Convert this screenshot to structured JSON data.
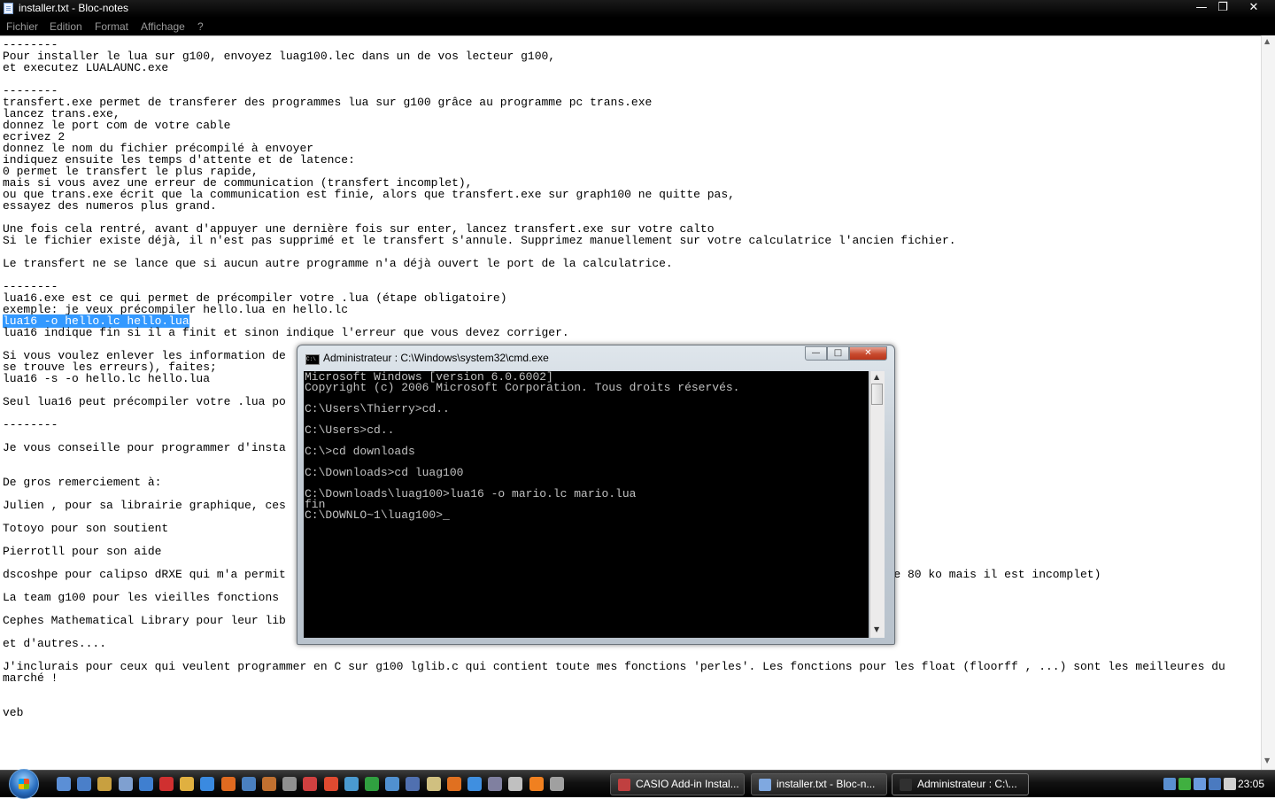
{
  "notepad": {
    "title": "installer.txt - Bloc-notes",
    "controls": {
      "minimize": "—",
      "maximize": "❐",
      "close": "✕"
    },
    "menu": [
      "Fichier",
      "Edition",
      "Format",
      "Affichage",
      "?"
    ],
    "lines_before_selection": [
      "--------",
      "Pour installer le lua sur g100, envoyez luag100.lec dans un de vos lecteur g100,",
      "et executez LUALAUNC.exe",
      "",
      "--------",
      "transfert.exe permet de transferer des programmes lua sur g100 grâce au programme pc trans.exe",
      "lancez trans.exe,",
      "donnez le port com de votre cable",
      "ecrivez 2",
      "donnez le nom du fichier précompilé à envoyer",
      "indiquez ensuite les temps d'attente et de latence:",
      "0 permet le transfert le plus rapide,",
      "mais si vous avez une erreur de communication (transfert incomplet),",
      "ou que trans.exe écrit que la communication est finie, alors que transfert.exe sur graph100 ne quitte pas,",
      "essayez des numeros plus grand.",
      "",
      "Une fois cela rentré, avant d'appuyer une dernière fois sur enter, lancez transfert.exe sur votre calto",
      "Si le fichier existe déjà, il n'est pas supprimé et le transfert s'annule. Supprimez manuellement sur votre calculatrice l'ancien fichier.",
      "",
      "Le transfert ne se lance que si aucun autre programme n'a déjà ouvert le port de la calculatrice.",
      "",
      "--------",
      "lua16.exe est ce qui permet de précompiler votre .lua (étape obligatoire)",
      "exemple: je veux précompiler hello.lua en hello.lc"
    ],
    "selected_line": "lua16 -o hello.lc hello.lua",
    "lines_after_selection": [
      "lua16 indique fin si il a finit et sinon indique l'erreur que vous devez corriger.",
      "",
      "Si vous voulez enlever les information de                                                                       e ligne",
      "se trouve les erreurs), faites;",
      "lua16 -s -o hello.lc hello.lua",
      "",
      "Seul lua16 peut précompiler votre .lua po",
      "",
      "--------",
      "",
      "Je vous conseille pour programmer d'insta",
      "",
      "",
      "De gros remerciement à:",
      "",
      "Julien , pour sa librairie graphique, ces",
      "",
      "Totoyo pour son soutient",
      "",
      "Pierrotll pour son aide",
      "",
      "dscoshpe pour calipso dRXE qui m'a permit                                                                        cher pour plus de 80 ko mais il est incomplet)",
      "",
      "La team g100 pour les vieilles fonctions",
      "",
      "Cephes Mathematical Library pour leur lib",
      "",
      "et d'autres....",
      "",
      "J'inclurais pour ceux qui veulent programmer en C sur g100 lglib.c qui contient toute mes fonctions 'perles'. Les fonctions pour les float (floorff , ...) sont les meilleures du",
      "marché !",
      "",
      "",
      "veb"
    ]
  },
  "cmd": {
    "title": "Administrateur : C:\\Windows\\system32\\cmd.exe",
    "icon_text": "C:\\",
    "controls": {
      "minimize": "—",
      "maximize": "□",
      "close": "✕"
    },
    "lines": [
      "Microsoft Windows [version 6.0.6002]",
      "Copyright (c) 2006 Microsoft Corporation. Tous droits réservés.",
      "",
      "C:\\Users\\Thierry>cd..",
      "",
      "C:\\Users>cd..",
      "",
      "C:\\>cd downloads",
      "",
      "C:\\Downloads>cd luag100",
      "",
      "C:\\Downloads\\luag100>lua16 -o mario.lc mario.lua",
      "fin"
    ],
    "prompt": "C:\\DOWNLO~1\\luag100>",
    "cursor": "_"
  },
  "taskbar": {
    "quick_launch": [
      {
        "name": "show-desktop-icon",
        "color": "#5b8fd6"
      },
      {
        "name": "switch-windows-icon",
        "color": "#4a7fc9"
      },
      {
        "name": "tool-icon",
        "color": "#c8a040"
      },
      {
        "name": "app-icon",
        "color": "#7fa0d0"
      },
      {
        "name": "chart-icon",
        "color": "#3f7fd0"
      },
      {
        "name": "gmail-icon",
        "color": "#d03030"
      },
      {
        "name": "folder-icon",
        "color": "#e0b040"
      },
      {
        "name": "ie-icon",
        "color": "#3a8ae0"
      },
      {
        "name": "firefox-icon",
        "color": "#e06a20"
      },
      {
        "name": "thunderbird-icon",
        "color": "#4a80c0"
      },
      {
        "name": "games-icon",
        "color": "#c07030"
      },
      {
        "name": "settings-icon",
        "color": "#909090"
      },
      {
        "name": "tools-icon",
        "color": "#d04040"
      },
      {
        "name": "sync-icon",
        "color": "#e04a30"
      },
      {
        "name": "network-icon",
        "color": "#4a9ad0"
      },
      {
        "name": "excel-icon",
        "color": "#30a040"
      },
      {
        "name": "globe-icon",
        "color": "#5090d0"
      },
      {
        "name": "help-icon",
        "color": "#5070b0"
      },
      {
        "name": "media-icon",
        "color": "#d0c080"
      },
      {
        "name": "puzzle-icon",
        "color": "#e07020"
      },
      {
        "name": "browser-icon",
        "color": "#3f8fe0"
      },
      {
        "name": "image-icon",
        "color": "#8080a0"
      },
      {
        "name": "video-icon",
        "color": "#c0c0c0"
      },
      {
        "name": "vlc-icon",
        "color": "#f08020"
      },
      {
        "name": "volume-icon",
        "color": "#a0a0a0"
      }
    ],
    "tasks": [
      {
        "label": "CASIO Add-in Instal...",
        "color": "#c04040",
        "active": false
      },
      {
        "label": "installer.txt - Bloc-n...",
        "color": "#7fa8e0",
        "active": false
      },
      {
        "label": "Administrateur : C:\\...",
        "color": "#303030",
        "active": true
      }
    ],
    "tray_icons": [
      {
        "name": "network-tray-icon",
        "color": "#5a8fd0"
      },
      {
        "name": "check-tray-icon",
        "color": "#40b040"
      },
      {
        "name": "sync-tray-icon",
        "color": "#6a9ae0"
      },
      {
        "name": "monitor-tray-icon",
        "color": "#4a7ac0"
      },
      {
        "name": "volume-tray-icon",
        "color": "#d0d0d0"
      }
    ],
    "clock": "23:05"
  }
}
